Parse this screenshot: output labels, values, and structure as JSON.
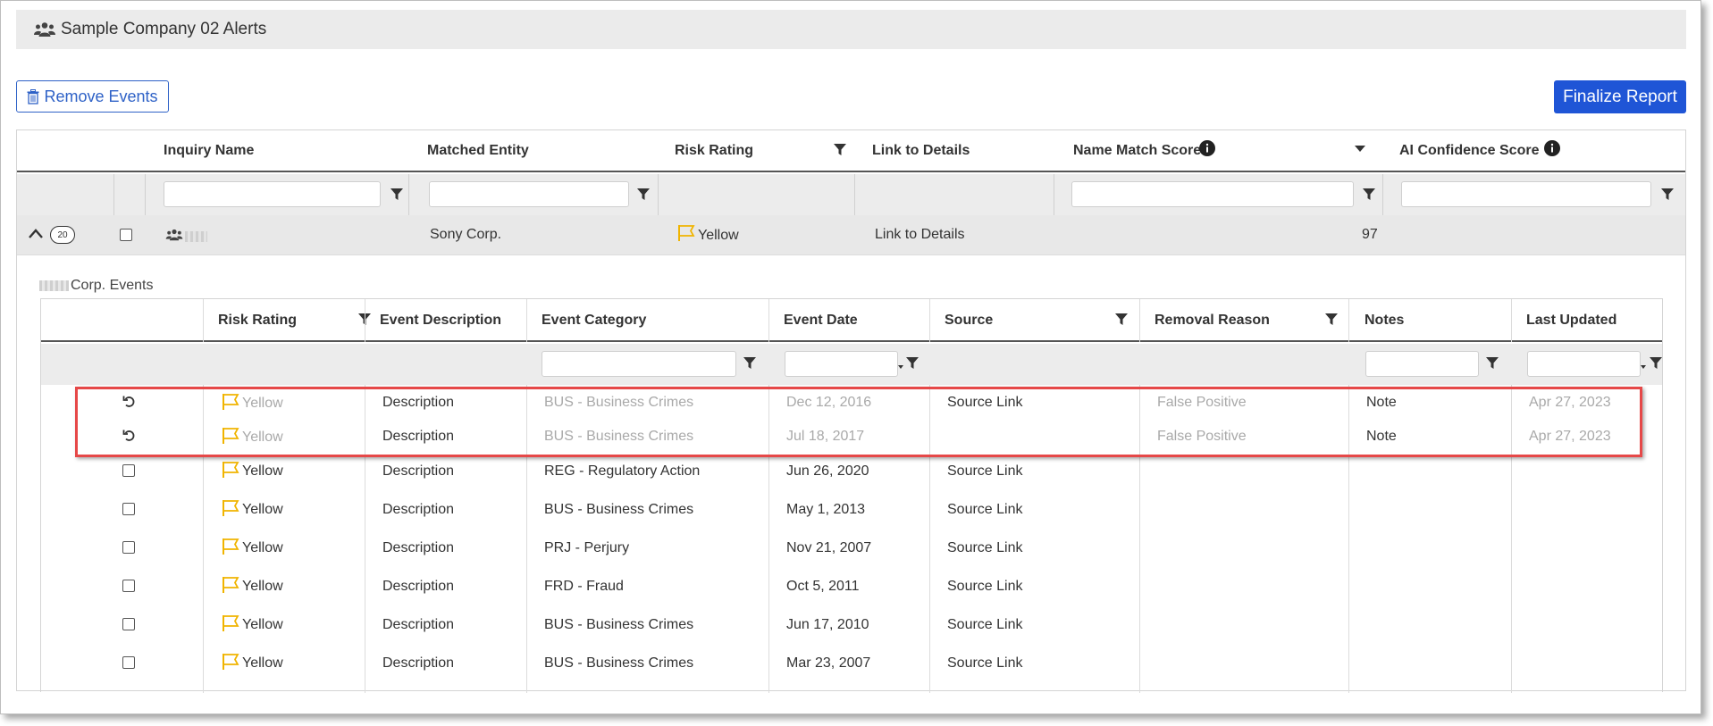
{
  "page": {
    "title": "Sample Company 02 Alerts"
  },
  "toolbar": {
    "remove_label": "Remove Events",
    "finalize_label": "Finalize Report"
  },
  "main_table": {
    "headers": {
      "inquiry_name": "Inquiry Name",
      "matched_entity": "Matched Entity",
      "risk_rating": "Risk Rating",
      "link_to_details": "Link to Details",
      "name_match_score": "Name Match Score",
      "ai_confidence_score": "AI Confidence Score"
    },
    "row": {
      "count_badge": "20",
      "matched_entity": "Sony Corp.",
      "risk_rating": "Yellow",
      "link_to_details": "Link to Details",
      "name_match_score": "97"
    }
  },
  "events_table": {
    "title": "Corp. Events",
    "headers": {
      "risk_rating": "Risk Rating",
      "event_description": "Event Description",
      "event_category": "Event Category",
      "event_date": "Event Date",
      "source": "Source",
      "removal_reason": "Removal Reason",
      "notes": "Notes",
      "last_updated": "Last Updated"
    },
    "rows": [
      {
        "risk": "Yellow",
        "description": "Description",
        "category": "BUS - Business Crimes",
        "date": "Dec 12, 2016",
        "source": "Source Link",
        "removal_reason": "False Positive",
        "notes": "Note",
        "last_updated": "Apr 27, 2023"
      },
      {
        "risk": "Yellow",
        "description": "Description",
        "category": "BUS - Business Crimes",
        "date": "Jul 18, 2017",
        "source": "",
        "removal_reason": "False Positive",
        "notes": "Note",
        "last_updated": "Apr 27, 2023"
      },
      {
        "risk": "Yellow",
        "description": "Description",
        "category": "REG - Regulatory Action",
        "date": "Jun 26, 2020",
        "source": "Source Link",
        "removal_reason": "",
        "notes": "",
        "last_updated": ""
      },
      {
        "risk": "Yellow",
        "description": "Description",
        "category": "BUS - Business Crimes",
        "date": "May 1, 2013",
        "source": "Source Link",
        "removal_reason": "",
        "notes": "",
        "last_updated": ""
      },
      {
        "risk": "Yellow",
        "description": "Description",
        "category": "PRJ - Perjury",
        "date": "Nov 21, 2007",
        "source": "Source Link",
        "removal_reason": "",
        "notes": "",
        "last_updated": ""
      },
      {
        "risk": "Yellow",
        "description": "Description",
        "category": "FRD - Fraud",
        "date": "Oct 5, 2011",
        "source": "Source Link",
        "removal_reason": "",
        "notes": "",
        "last_updated": ""
      },
      {
        "risk": "Yellow",
        "description": "Description",
        "category": "BUS - Business Crimes",
        "date": "Jun 17, 2010",
        "source": "Source Link",
        "removal_reason": "",
        "notes": "",
        "last_updated": ""
      },
      {
        "risk": "Yellow",
        "description": "Description",
        "category": "BUS - Business Crimes",
        "date": "Mar 23, 2007",
        "source": "Source Link",
        "removal_reason": "",
        "notes": "",
        "last_updated": ""
      }
    ]
  },
  "colors": {
    "accent": "#2f62c7",
    "primary_button": "#1f55d6",
    "flag": "#f0b400",
    "highlight": "#e64848"
  },
  "icons": {
    "users": "users-icon",
    "trash": "trash-icon",
    "filter": "filter-icon",
    "info": "info-icon",
    "sort": "sort-down-icon",
    "collapse": "chevron-up-icon",
    "flag": "flag-icon",
    "undo": "undo-icon"
  }
}
